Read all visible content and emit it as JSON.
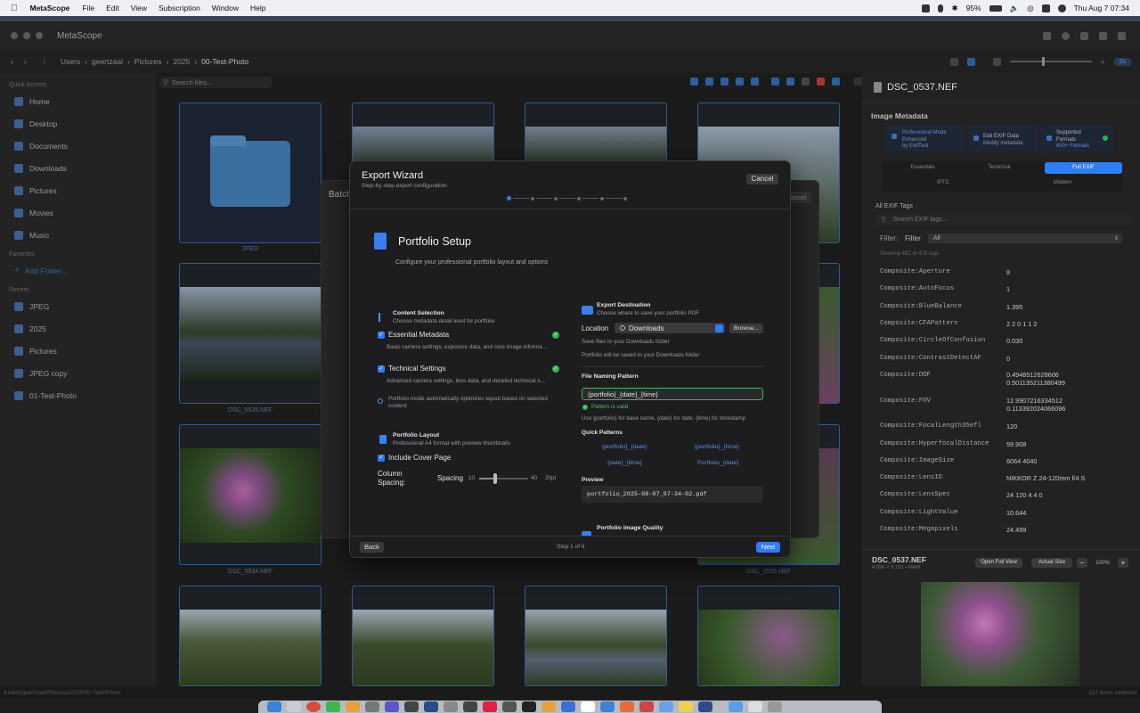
{
  "menubar": {
    "app": "MetaScope",
    "items": [
      "File",
      "Edit",
      "View",
      "Subscription",
      "Window",
      "Help"
    ],
    "battery": "95%",
    "clock": "Thu Aug 7  07:34"
  },
  "window": {
    "title": "MetaScope"
  },
  "nav": {
    "breadcrumb": [
      "Users",
      "geertzaal",
      "Pictures",
      "2025",
      "00-Test-Photo"
    ]
  },
  "sidebar": {
    "quick_access_header": "Quick Access",
    "quick_access": [
      "Home",
      "Desktop",
      "Documents",
      "Downloads",
      "Pictures",
      "Movies",
      "Music"
    ],
    "favorites_header": "Favorites",
    "add_folder": "Add Folder...",
    "recent_header": "Recent",
    "recent": [
      "JPEG",
      "2025",
      "Pictures",
      "JPEG copy",
      "01-Test-Photo"
    ]
  },
  "search": {
    "placeholder": "Search files..."
  },
  "grid": {
    "labels": [
      "JPEG",
      "",
      "",
      "",
      "DSC_0535.NEF",
      "",
      "",
      "",
      "DSC_0534.NEF",
      "",
      "",
      "DSC_0535.NEF"
    ]
  },
  "status": {
    "path": "/Users/geertzaal/Pictures/2025/00-Test-Photo",
    "selection": "112 items selected"
  },
  "zoom_toolbar": {
    "pill": "2x"
  },
  "batch_panel": {
    "title": "Batch",
    "cancel": "Cancel"
  },
  "wizard": {
    "title": "Export Wizard",
    "subtitle": "Step-by-step export configuration",
    "cancel": "Cancel",
    "section_title": "Portfolio Setup",
    "section_subtitle": "Configure your professional portfolio layout and options",
    "content_selection": {
      "title": "Content Selection",
      "desc": "Choose metadata detail level for portfolio",
      "opt1_label": "Essential Metadata",
      "opt1_desc": "Basic camera settings, exposure data, and core image informa...",
      "opt2_label": "Technical Settings",
      "opt2_desc": "Advanced camera settings, lens data, and detailed technical s...",
      "info": "Portfolio mode automatically optimizes layout based on selected content"
    },
    "layout": {
      "title": "Portfolio Layout",
      "desc": "Professional A4 format with preview thumbnails",
      "cover_label": "Include Cover Page",
      "column_label": "Column Spacing:",
      "spacing_label": "Spacing",
      "min": "10",
      "value": "40",
      "max": "20pt",
      "slider_fraction": 0.33
    },
    "destination": {
      "title": "Export Destination",
      "desc": "Choose where to save your portfolio PDF",
      "location_label": "Location",
      "location_value": "Downloads",
      "browse": "Browse...",
      "hint": "Save files to your Downloads folder",
      "info": "Portfolio will be saved to your Downloads folder"
    },
    "naming": {
      "title": "File Naming Pattern",
      "value": "{portfolio}_{date}_{time}",
      "valid": "Pattern is valid",
      "help": "Use {portfolio} for base name, {date} for date, {time} for timestamp",
      "quick_title": "Quick Patterns",
      "quick": [
        "{portfolio}_{date}",
        "{portfolio}_{time}",
        "{date}_{time}",
        "Portfolio_{date}"
      ],
      "preview_title": "Preview",
      "preview_value": "portfolio_2025-08-07_07-34-02.pdf"
    },
    "quality_title": "Portfolio Image Quality",
    "back": "Back",
    "step": "Step 1 of 6",
    "next": "Next"
  },
  "inspector": {
    "filename": "DSC_0537.NEF",
    "metadata_header": "Image Metadata",
    "info_cards": [
      {
        "title": "Professional Mode",
        "sub1": "Enhanced",
        "sub2": "by ExifTool"
      },
      {
        "title": "Edit EXIF Data",
        "sub1": "Modify metadata",
        "sub2": ""
      },
      {
        "title": "Supported Formats",
        "sub1": "",
        "sub2": "600+ Formats"
      }
    ],
    "tabs": [
      "Essentials",
      "Technical",
      "Full EXIF",
      "IPTC",
      "Modern"
    ],
    "all_tags_header": "All EXIF Tags",
    "search_placeholder": "Search EXIF tags...",
    "filter_label": "Filter:",
    "filter_label2": "Filter",
    "filter_value": "All",
    "showing": "Showing 482 of 476 tags",
    "rows": [
      {
        "k": "Composite:Aperture",
        "v": "8"
      },
      {
        "k": "Composite:AutoFocus",
        "v": "1"
      },
      {
        "k": "Composite:BlueBalance",
        "v": "1.395"
      },
      {
        "k": "Composite:CFAPattern",
        "v": "2 2 0 1 1 2"
      },
      {
        "k": "Composite:CircleOfConfusion",
        "v": "0.030"
      },
      {
        "k": "Composite:ContrastDetectAF",
        "v": "0"
      },
      {
        "k": "Composite:DOF",
        "v": "0.4948512628606\n0.501135211380499"
      },
      {
        "k": "Composite:FOV",
        "v": "12.9907216334512\n0.113392024066096"
      },
      {
        "k": "Composite:FocalLength35efl",
        "v": "120"
      },
      {
        "k": "Composite:HyperfocalDistance",
        "v": "59.908"
      },
      {
        "k": "Composite:ImageSize",
        "v": "6064 4040"
      },
      {
        "k": "Composite:LensID",
        "v": "NIKKOR Z 24-120mm f/4 S"
      },
      {
        "k": "Composite:LensSpec",
        "v": "24 120 4 4 0"
      },
      {
        "k": "Composite:LightValue",
        "v": "10.644"
      },
      {
        "k": "Composite:Megapixels",
        "v": "24.499"
      }
    ],
    "preview_name": "DSC_0537.NEF",
    "preview_meta": "4,096 × 2,731 • RAW",
    "open_full": "Open Full View",
    "actual_size": "Actual Size",
    "zoom": "100%"
  }
}
